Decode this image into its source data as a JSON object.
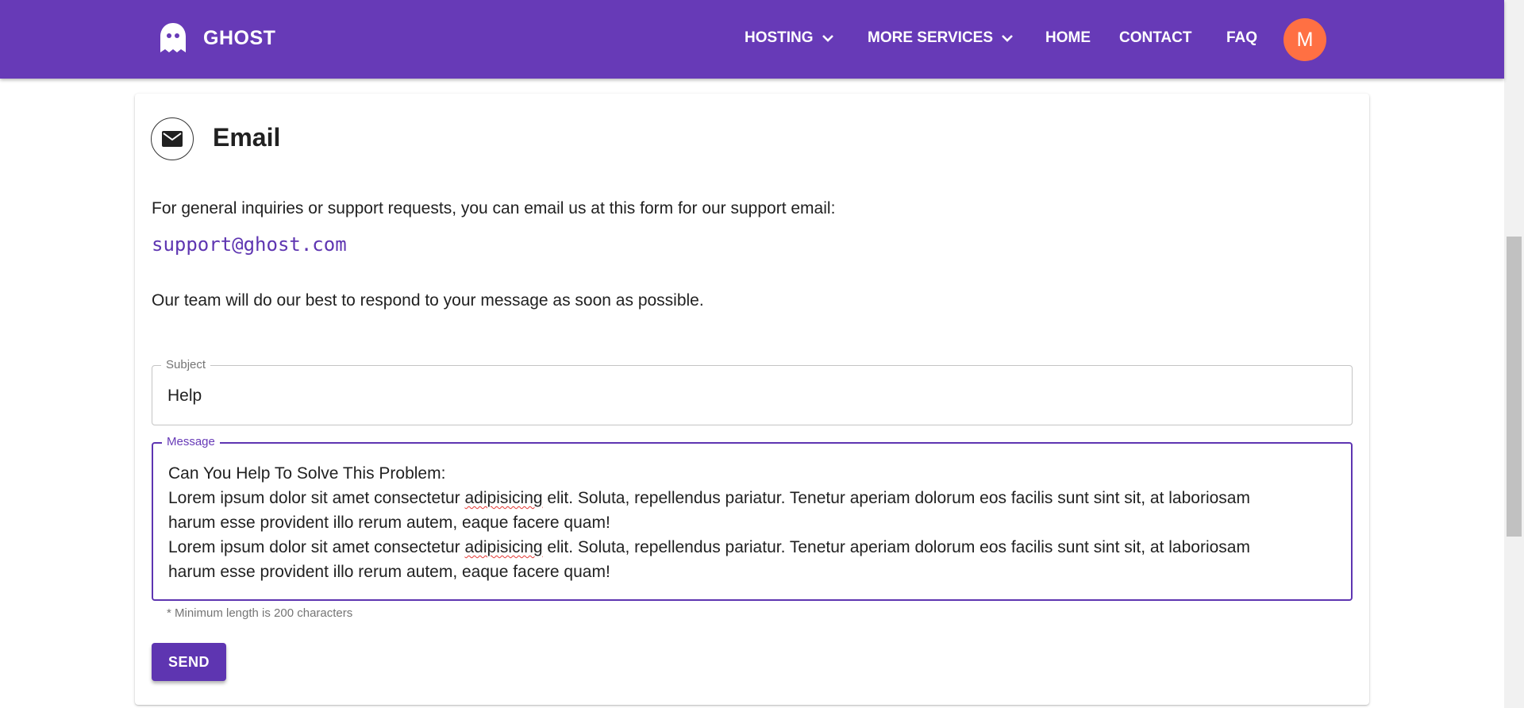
{
  "navbar": {
    "brand": "GHOST",
    "items": [
      {
        "label": "HOSTING",
        "dropdown": true
      },
      {
        "label": "MORE SERVICES",
        "dropdown": true
      },
      {
        "label": "HOME"
      },
      {
        "label": "CONTACT"
      },
      {
        "label": "FAQ"
      }
    ],
    "avatar_initial": "M",
    "colors": {
      "bar": "#673ab7",
      "avatar": "#ff7043"
    }
  },
  "card": {
    "icon": "mail-icon",
    "title": "Email",
    "intro": "For general inquiries or support requests, you can email us at this form for our support email:",
    "email": "support@ghost.com",
    "note": "Our team will do our best to respond to your message as soon as possible."
  },
  "form": {
    "subject": {
      "label": "Subject",
      "value": "Help"
    },
    "message": {
      "label": "Message",
      "lines": [
        "Can You Help To Solve This Problem:",
        "Lorem ipsum dolor sit amet consectetur adipisicing elit. Soluta, repellendus pariatur. Tenetur aperiam dolorum eos facilis sunt sint sit, at laboriosam",
        "harum esse provident illo rerum autem, eaque facere quam!",
        "Lorem ipsum dolor sit amet consectetur adipisicing elit. Soluta, repellendus pariatur. Tenetur aperiam dolorum eos facilis sunt sint sit, at laboriosam",
        "harum esse provident illo rerum autem, eaque facere quam!"
      ],
      "misspelled_word": "adipisicing"
    },
    "helper": "* Minimum length is 200 characters",
    "send_label": "SEND",
    "accent": "#5e35b1"
  }
}
